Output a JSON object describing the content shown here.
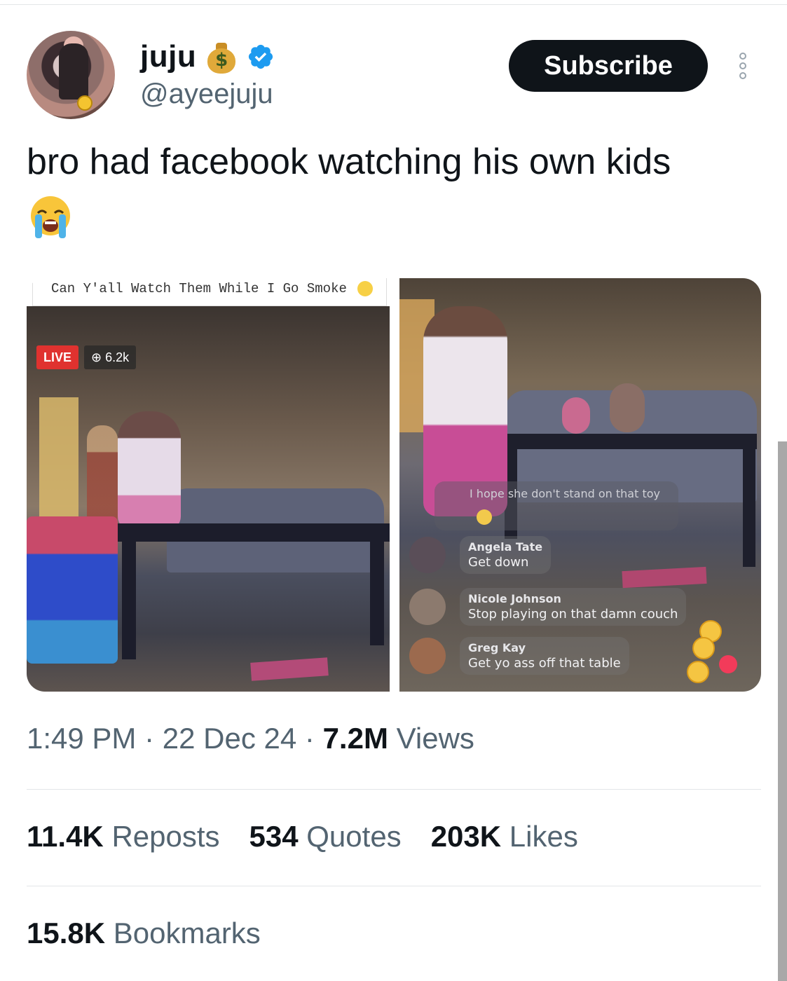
{
  "author": {
    "display_name": "juju",
    "handle": "@ayeejuju",
    "name_emoji_icon": "money-bag-icon",
    "verified_icon": "verified-badge-icon"
  },
  "actions": {
    "subscribe_label": "Subscribe",
    "more_icon": "more-options-icon"
  },
  "tweet": {
    "text": "bro had facebook watching his own kids",
    "emoji_icon": "loudly-crying-face-icon"
  },
  "media": {
    "left": {
      "caption": "Can Y'all Watch Them While I Go Smoke",
      "live_label": "LIVE",
      "viewers": "⊕ 6.2k"
    },
    "right": {
      "faded_comment": "I hope she don't stand on that toy",
      "comments": [
        {
          "name": "Angela Tate",
          "text": "Get down"
        },
        {
          "name": "Nicole Johnson",
          "text": "Stop playing on that damn couch"
        },
        {
          "name": "Greg Kay",
          "text": "Get yo ass off that table"
        }
      ]
    }
  },
  "meta": {
    "time": "1:49 PM",
    "date": "22 Dec 24",
    "views_count": "7.2M",
    "views_label": "Views",
    "separator": "·"
  },
  "stats": {
    "reposts_count": "11.4K",
    "reposts_label": "Reposts",
    "quotes_count": "534",
    "quotes_label": "Quotes",
    "likes_count": "203K",
    "likes_label": "Likes",
    "bookmarks_count": "15.8K",
    "bookmarks_label": "Bookmarks"
  },
  "colors": {
    "text_primary": "#0f1419",
    "text_secondary": "#536471",
    "button_bg": "#0f1419",
    "verified_blue": "#1d9bf0",
    "live_red": "#e0322f"
  }
}
